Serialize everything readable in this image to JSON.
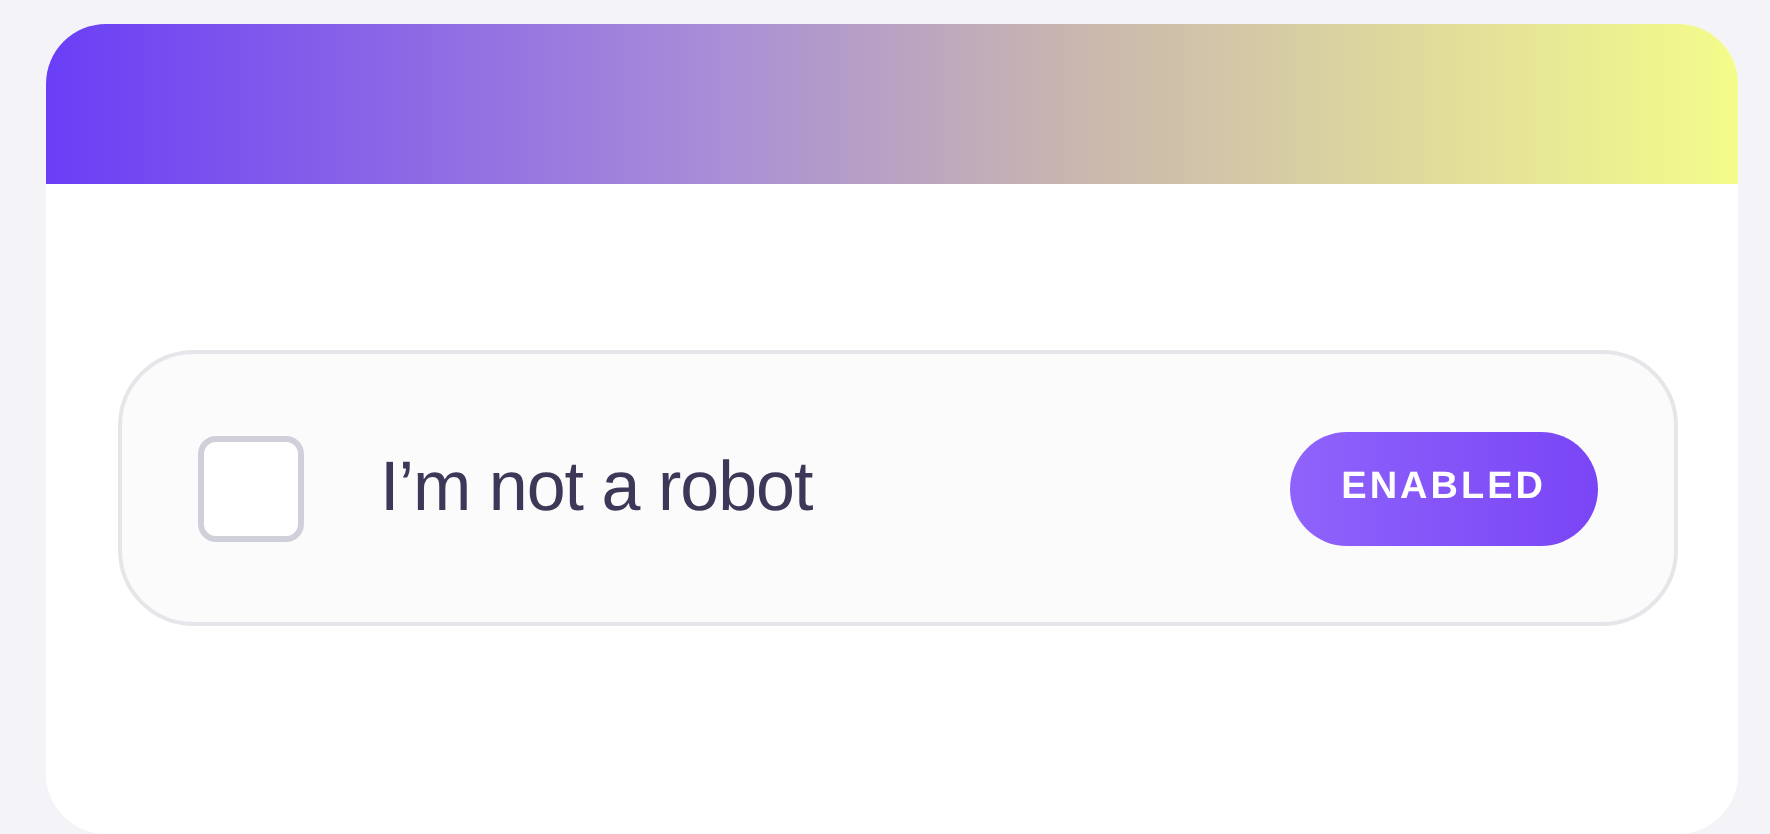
{
  "captcha": {
    "label": "I’m not a robot",
    "checked": false,
    "badge": "ENABLED"
  }
}
